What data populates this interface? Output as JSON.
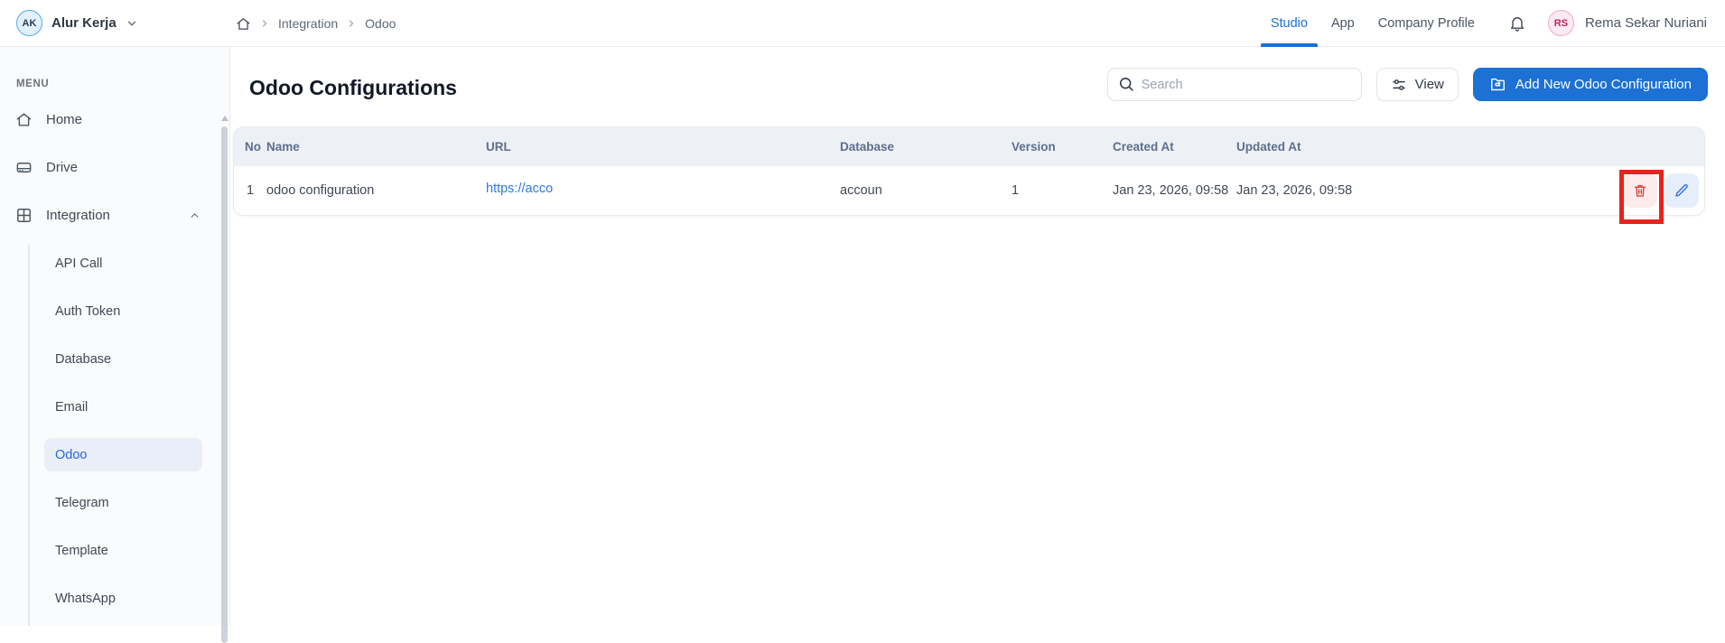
{
  "topbar": {
    "workspace": {
      "initials": "AK",
      "name": "Alur Kerja"
    },
    "breadcrumb": {
      "home": "home-icon",
      "items": [
        "Integration",
        "Odoo"
      ]
    },
    "tabs": [
      {
        "label": "Studio",
        "active": true
      },
      {
        "label": "App",
        "active": false
      },
      {
        "label": "Company Profile",
        "active": false
      }
    ],
    "notifications_icon": "bell-icon",
    "user": {
      "initials": "RS",
      "name": "Rema Sekar Nuriani"
    }
  },
  "sidebar": {
    "section_label": "MENU",
    "items": [
      {
        "label": "Home",
        "icon": "home-icon"
      },
      {
        "label": "Drive",
        "icon": "drive-icon"
      },
      {
        "label": "Integration",
        "icon": "integration-icon",
        "expanded": true,
        "children": [
          {
            "label": "API Call",
            "active": false
          },
          {
            "label": "Auth Token",
            "active": false
          },
          {
            "label": "Database",
            "active": false
          },
          {
            "label": "Email",
            "active": false
          },
          {
            "label": "Odoo",
            "active": true
          },
          {
            "label": "Telegram",
            "active": false
          },
          {
            "label": "Template",
            "active": false
          },
          {
            "label": "WhatsApp",
            "active": false
          }
        ]
      }
    ]
  },
  "main": {
    "title": "Odoo Configurations",
    "search": {
      "placeholder": "Search",
      "icon": "search-icon"
    },
    "view_button": {
      "label": "View",
      "icon": "sliders-icon"
    },
    "add_button": {
      "label": "Add New Odoo Configuration",
      "icon": "folder-add-icon"
    },
    "table": {
      "columns": [
        "No",
        "Name",
        "URL",
        "Database",
        "Version",
        "Created At",
        "Updated At"
      ],
      "rows": [
        {
          "no": "1",
          "name": "odoo configuration",
          "url": "https://acco",
          "database": "accoun",
          "version": "1",
          "created_at": "Jan 23, 2026, 09:58",
          "updated_at": "Jan 23, 2026, 09:58",
          "actions": {
            "delete_icon": "trash-icon",
            "edit_icon": "pencil-icon"
          }
        }
      ]
    }
  },
  "annotation": {
    "type": "highlight-rectangle",
    "target": "delete-button",
    "color": "#e8221c"
  },
  "colors": {
    "accent_blue": "#1a6fd6",
    "add_button_blue": "#1d70d4",
    "link_blue": "#2e7be0",
    "active_item_bg": "#e9eef8",
    "table_header_bg": "#edf1f6",
    "delete_red": "#dd3b37",
    "delete_bg": "#fcebea",
    "edit_bg": "#e7eefb",
    "annotation_red": "#e8221c"
  }
}
